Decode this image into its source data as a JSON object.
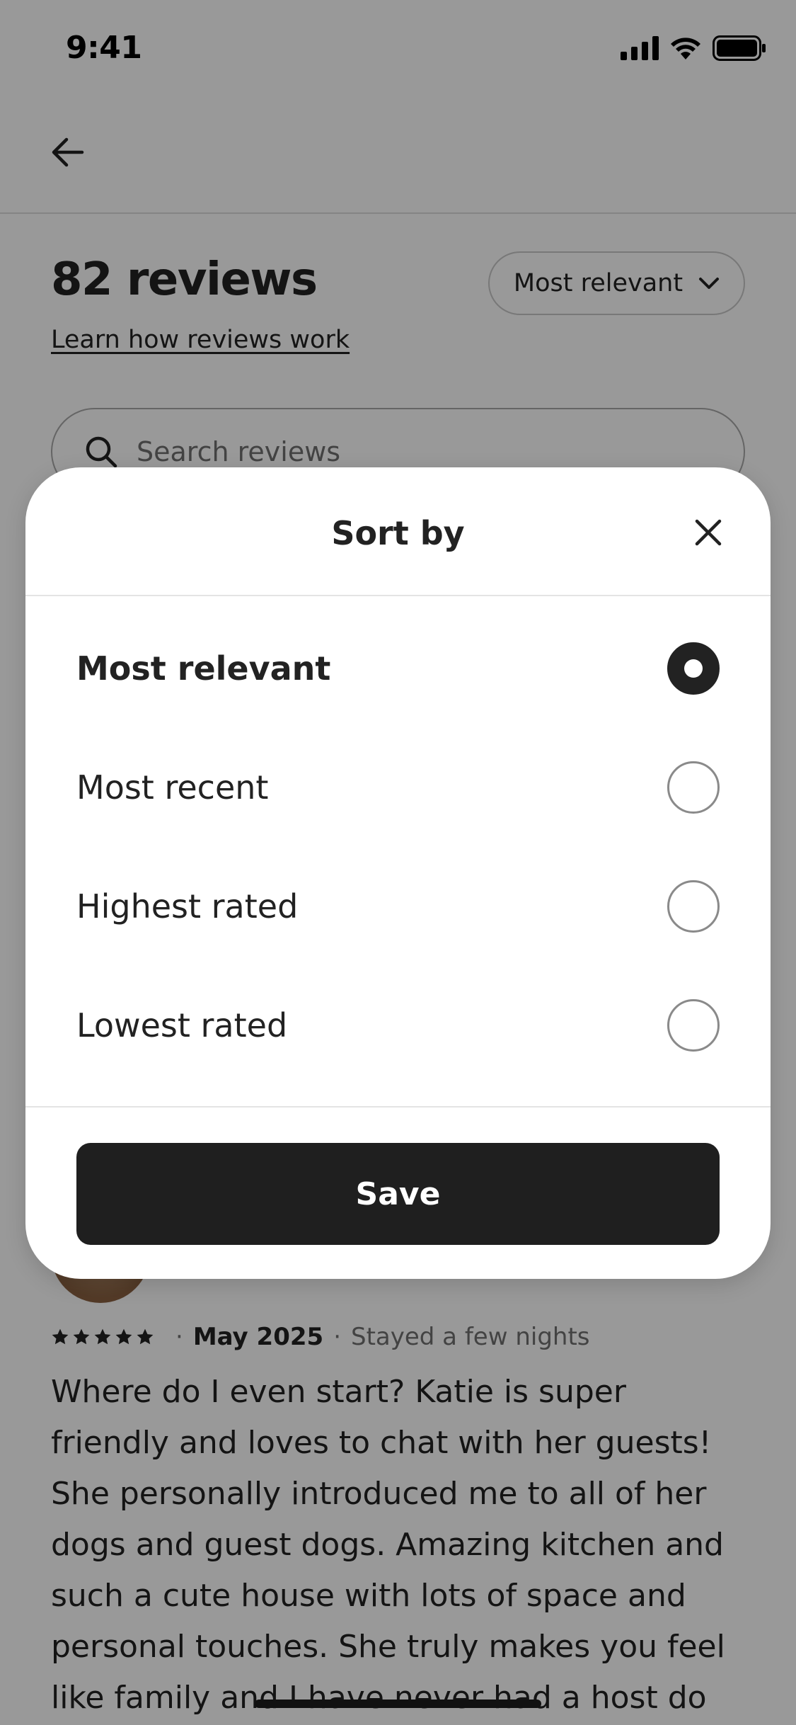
{
  "status_bar": {
    "time": "9:41"
  },
  "header": {
    "title": "82 reviews",
    "learn_link": "Learn how reviews work",
    "sort_button_label": "Most relevant"
  },
  "search": {
    "placeholder": "Search reviews"
  },
  "review": {
    "rating_stars": 5,
    "date": "May 2025",
    "stay": "Stayed a few nights",
    "separator": "·",
    "text": "Where do I even start? Katie is super friendly and loves to chat with her guests! She personally introduced me to all of her dogs and guest dogs. Amazing kitchen and such a cute house with lots of space and personal touches. She truly makes you feel like family and I have never had a host do"
  },
  "sort_sheet": {
    "title": "Sort by",
    "options": [
      {
        "label": "Most relevant",
        "selected": true
      },
      {
        "label": "Most recent",
        "selected": false
      },
      {
        "label": "Highest rated",
        "selected": false
      },
      {
        "label": "Lowest rated",
        "selected": false
      }
    ],
    "save_label": "Save"
  },
  "icons": {
    "back": "arrow-left-icon",
    "sort_chevron": "chevron-down-icon",
    "search": "search-icon",
    "close": "close-icon",
    "star": "star-icon"
  },
  "colors": {
    "text_primary": "#222222",
    "text_secondary": "#717171",
    "save_button": "#1f1f1f",
    "overlay": "rgba(0,0,0,0.40)"
  }
}
